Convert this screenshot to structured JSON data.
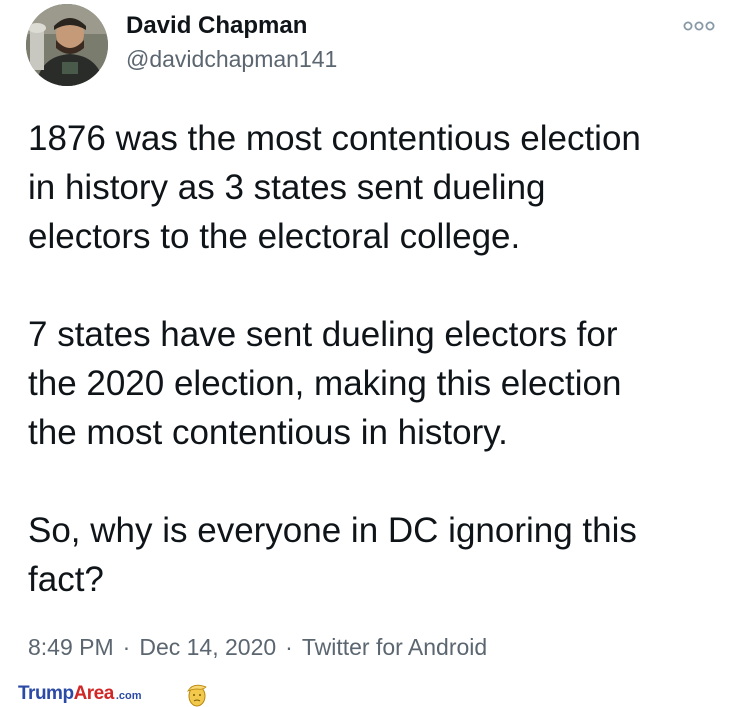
{
  "tweet": {
    "author_name": "David Chapman",
    "author_handle": "@davidchapman141",
    "paragraphs": [
      "1876 was the most contentious election\nin history as 3 states sent dueling\nelectors to the electoral college.",
      "7 states have sent dueling electors for\nthe 2020 election, making this election\nthe most contentious in history.",
      "So, why is everyone in DC ignoring this\nfact?"
    ],
    "time": "8:49 PM",
    "date": "Dec 14, 2020",
    "source": "Twitter for Android",
    "separator": "·"
  },
  "icons": {
    "more": "more-options-icon",
    "avatar": "avatar"
  },
  "watermark": {
    "trump": "Trump",
    "area": "Area",
    "com": ".com",
    "logo": "trump-face-logo"
  },
  "colors": {
    "text_primary": "#0f1419",
    "text_secondary": "#5b6670",
    "watermark_blue": "#2b4aa6",
    "watermark_red": "#d02727"
  }
}
